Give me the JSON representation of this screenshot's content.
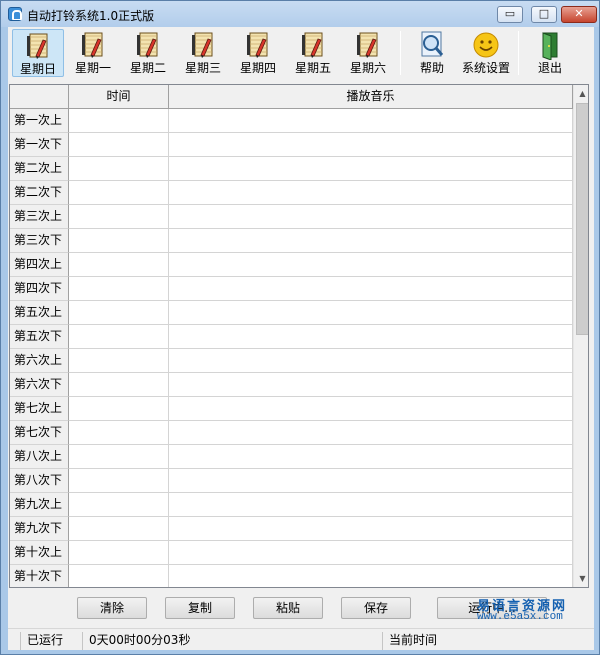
{
  "window": {
    "title": "自动打铃系统1.0正式版",
    "minimize_glyph": "▭",
    "maximize_glyph": "□",
    "close_glyph": "✕"
  },
  "toolbar": {
    "days": [
      {
        "label": "星期日",
        "active": true
      },
      {
        "label": "星期一",
        "active": false
      },
      {
        "label": "星期二",
        "active": false
      },
      {
        "label": "星期三",
        "active": false
      },
      {
        "label": "星期四",
        "active": false
      },
      {
        "label": "星期五",
        "active": false
      },
      {
        "label": "星期六",
        "active": false
      }
    ],
    "help": "帮助",
    "settings": "系统设置",
    "exit": "退出"
  },
  "grid": {
    "columns": [
      "时间",
      "播放音乐"
    ],
    "rows": [
      {
        "label": "第一次上",
        "time": "",
        "music": ""
      },
      {
        "label": "第一次下",
        "time": "",
        "music": ""
      },
      {
        "label": "第二次上",
        "time": "",
        "music": ""
      },
      {
        "label": "第二次下",
        "time": "",
        "music": ""
      },
      {
        "label": "第三次上",
        "time": "",
        "music": ""
      },
      {
        "label": "第三次下",
        "time": "",
        "music": ""
      },
      {
        "label": "第四次上",
        "time": "",
        "music": ""
      },
      {
        "label": "第四次下",
        "time": "",
        "music": ""
      },
      {
        "label": "第五次上",
        "time": "",
        "music": ""
      },
      {
        "label": "第五次下",
        "time": "",
        "music": ""
      },
      {
        "label": "第六次上",
        "time": "",
        "music": ""
      },
      {
        "label": "第六次下",
        "time": "",
        "music": ""
      },
      {
        "label": "第七次上",
        "time": "",
        "music": ""
      },
      {
        "label": "第七次下",
        "time": "",
        "music": ""
      },
      {
        "label": "第八次上",
        "time": "",
        "music": ""
      },
      {
        "label": "第八次下",
        "time": "",
        "music": ""
      },
      {
        "label": "第九次上",
        "time": "",
        "music": ""
      },
      {
        "label": "第九次下",
        "time": "",
        "music": ""
      },
      {
        "label": "第十次上",
        "time": "",
        "music": ""
      },
      {
        "label": "第十次下",
        "time": "",
        "music": ""
      }
    ]
  },
  "actions": {
    "clear": "清除",
    "copy": "复制",
    "paste": "粘贴",
    "save": "保存",
    "running": "运行中..."
  },
  "status": {
    "running_label": "已运行",
    "running_value": "0天00时00分03秒",
    "current_time_label": "当前时间"
  },
  "watermark": {
    "top": "易语言资源网",
    "bottom": "www.e5a5x.com"
  },
  "colors": {
    "title_bar": "#b2cdeb",
    "active_toolbar": "#cde6f7",
    "watermark": "#1460b0"
  }
}
